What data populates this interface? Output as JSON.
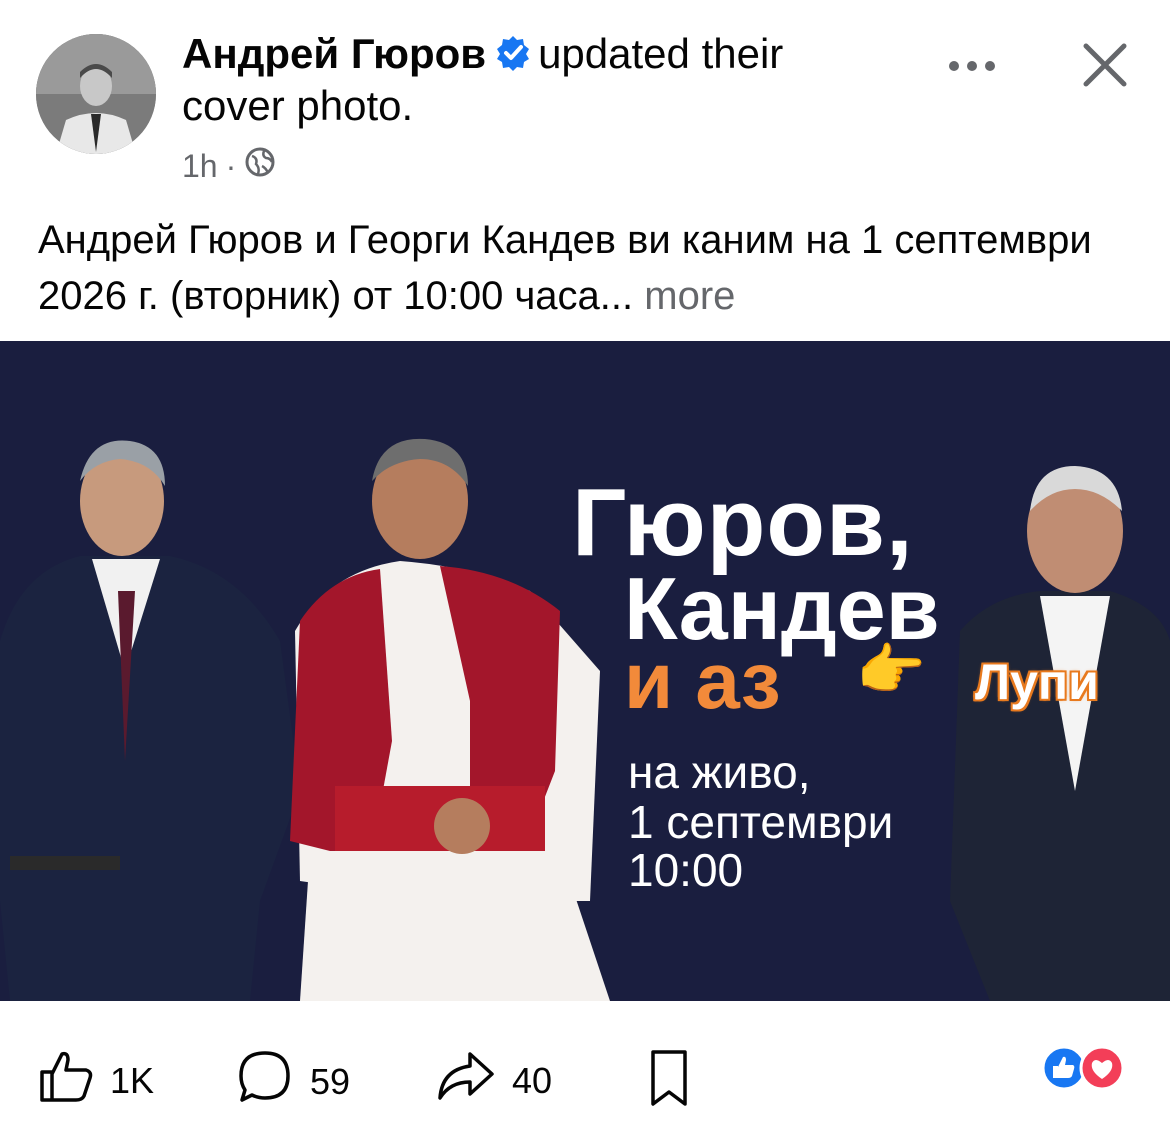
{
  "header": {
    "author_name": "Андрей Гюров",
    "action_text": "updated their cover photo.",
    "time": "1h",
    "dot": "·"
  },
  "post": {
    "text": "Андрей Гюров и Георги Кандев ви каним на 1 септември 2026 г. (вторник) от 10:00 часа...",
    "more_label": "more"
  },
  "banner": {
    "line1": "Гюров,",
    "line2": "Кандев",
    "line3": "и аз",
    "pointer": "👉",
    "sticker": "Лупи",
    "sub1": "на живо,",
    "sub2": "1 септември",
    "sub3": "10:00"
  },
  "actions": {
    "likes": "1K",
    "comments": "59",
    "shares": "40"
  },
  "colors": {
    "banner_bg": "#1a1e3f",
    "accent_orange": "#f28a3a",
    "verified_blue": "#1877f2",
    "love_red": "#f33e58",
    "meta_gray": "#65676b"
  }
}
